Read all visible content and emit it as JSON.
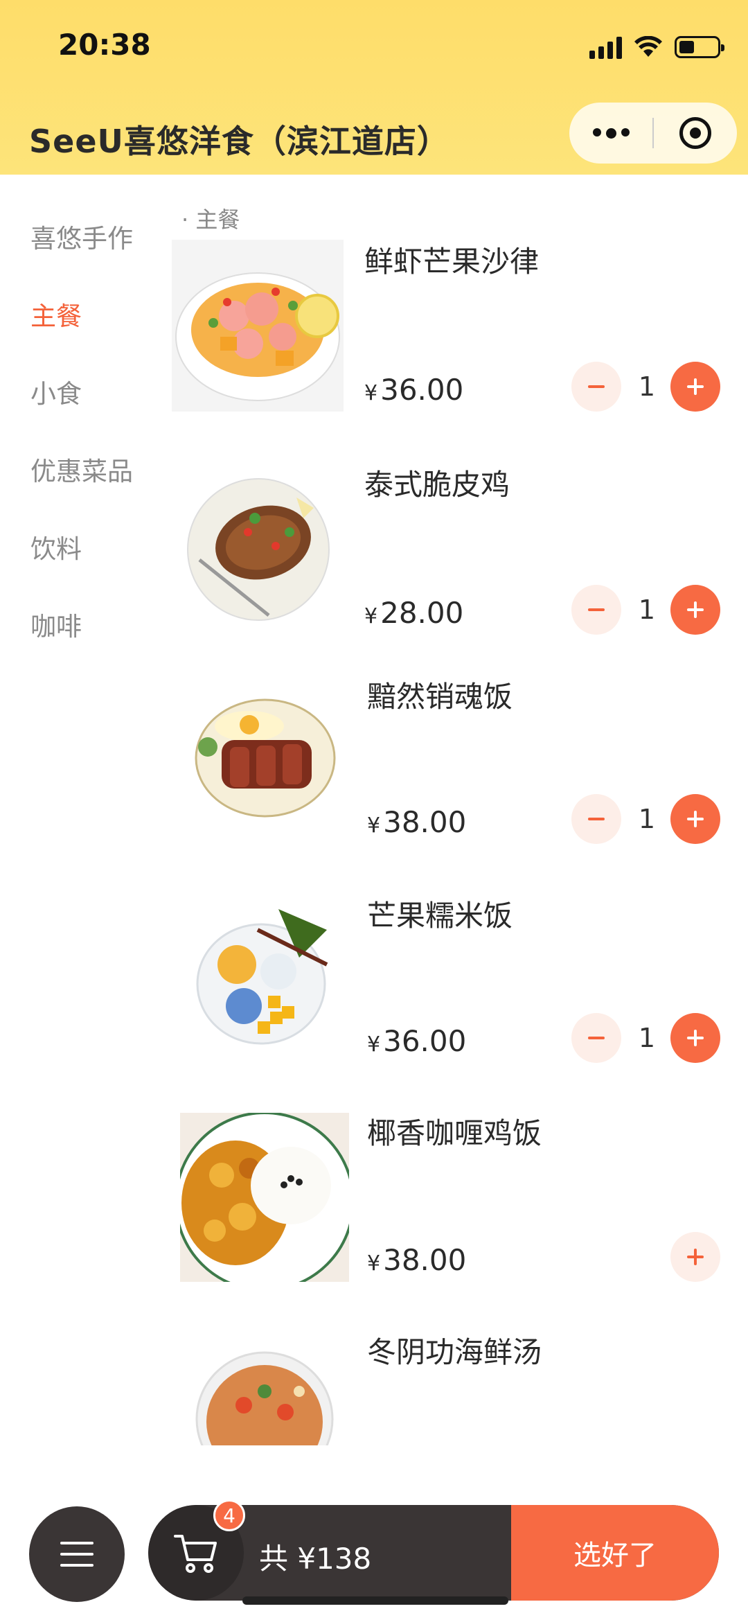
{
  "status_bar": {
    "time": "20:38"
  },
  "header": {
    "title": "SeeU喜悠洋食（滨江道店）"
  },
  "sidebar": {
    "categories": [
      "喜悠手作",
      "主餐",
      "小食",
      "优惠菜品",
      "饮料",
      "咖啡"
    ],
    "active": "主餐"
  },
  "menu": {
    "section_label": "· 主餐",
    "currency_symbol": "¥",
    "dishes": [
      {
        "name": "鲜虾芒果沙律",
        "price": "36.00",
        "quantity": "1"
      },
      {
        "name": "泰式脆皮鸡",
        "price": "28.00",
        "quantity": "1"
      },
      {
        "name": "黯然销魂饭",
        "price": "38.00",
        "quantity": "1"
      },
      {
        "name": "芒果糯米饭",
        "price": "36.00",
        "quantity": "1"
      },
      {
        "name": "椰香咖喱鸡饭",
        "price": "38.00",
        "quantity": ""
      },
      {
        "name": "冬阴功海鲜汤",
        "price": "",
        "quantity": ""
      }
    ]
  },
  "cart": {
    "badge_count": "4",
    "total": "共 ¥138",
    "checkout_label": "选好了"
  },
  "icons": {
    "menu": "hamburger-icon",
    "cart": "shopping-cart-icon",
    "more": "more-dots-icon",
    "close": "target-circle-icon"
  },
  "colors": {
    "accent": "#f76a43",
    "header": "#fedd6a",
    "bar": "#3a3535"
  }
}
